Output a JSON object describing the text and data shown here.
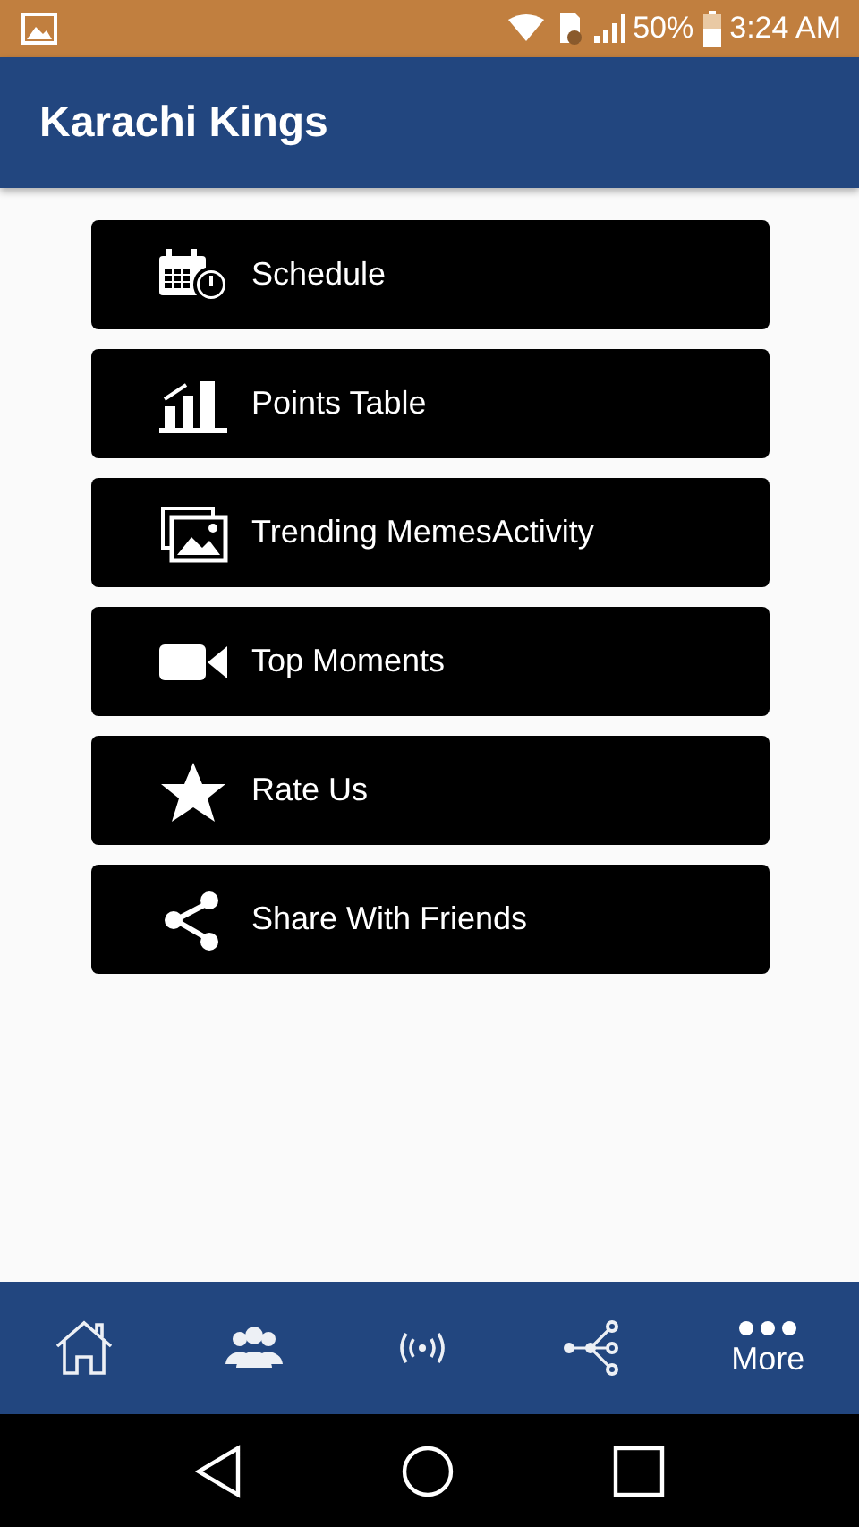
{
  "status_bar": {
    "battery": "50%",
    "time": "3:24 AM"
  },
  "app_bar": {
    "title": "Karachi Kings"
  },
  "menu": [
    {
      "kind": "schedule",
      "label": "Schedule"
    },
    {
      "kind": "chart",
      "label": "Points Table"
    },
    {
      "kind": "gallery",
      "label": "Trending MemesActivity"
    },
    {
      "kind": "video",
      "label": "Top Moments"
    },
    {
      "kind": "star",
      "label": "Rate Us"
    },
    {
      "kind": "share",
      "label": "Share With Friends"
    }
  ],
  "bottom_nav": [
    {
      "kind": "home",
      "selected": false
    },
    {
      "kind": "people",
      "selected": false
    },
    {
      "kind": "broadcast",
      "selected": false
    },
    {
      "kind": "network",
      "selected": false
    },
    {
      "kind": "more",
      "label": "More",
      "selected": true
    }
  ]
}
